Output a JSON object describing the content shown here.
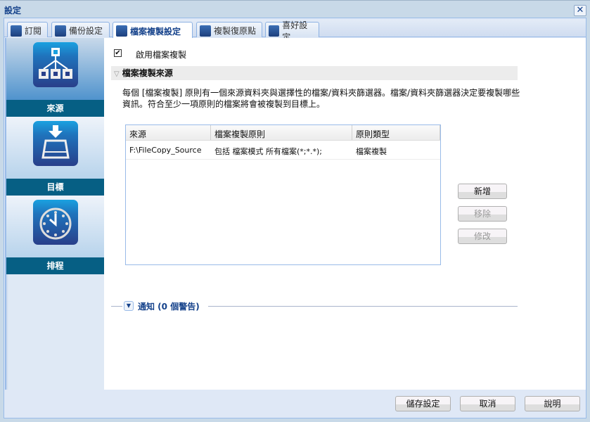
{
  "window": {
    "title": "設定",
    "close_icon": "close-icon"
  },
  "tabs": [
    {
      "label": "訂閱",
      "icon": "user-icon"
    },
    {
      "label": "備份設定",
      "icon": "backup-icon"
    },
    {
      "label": "檔案複製設定",
      "icon": "file-copy-icon",
      "active": true
    },
    {
      "label": "複製復原點",
      "icon": "recovery-point-icon"
    },
    {
      "label": "喜好設定",
      "icon": "gear-icon"
    }
  ],
  "sidebar": {
    "items": [
      {
        "label": "來源",
        "icon": "hierarchy-icon",
        "selected": true
      },
      {
        "label": "目標",
        "icon": "drive-download-icon"
      },
      {
        "label": "排程",
        "icon": "clock-icon"
      }
    ]
  },
  "main": {
    "enable_checkbox": {
      "label": "啟用檔案複製",
      "checked": true,
      "mark": "✔"
    },
    "section_title": "檔案複製來源",
    "description": "每個 [檔案複製] 原則有一個來源資料夾與選擇性的檔案/資料夾篩選器。檔案/資料夾篩選器決定要複製哪些資訊。符合至少一項原則的檔案將會被複製到目標上。",
    "table": {
      "columns": [
        "來源",
        "檔案複製原則",
        "原則類型"
      ],
      "rows": [
        [
          "F:\\FileCopy_Source",
          "包括 檔案模式 所有檔案(*;*.*);",
          "檔案複製"
        ]
      ]
    },
    "buttons": {
      "add": "新增",
      "remove": "移除",
      "modify": "修改"
    },
    "notification": "通知 (0 個警告)"
  },
  "footer": {
    "save": "儲存設定",
    "cancel": "取消",
    "help": "說明"
  }
}
